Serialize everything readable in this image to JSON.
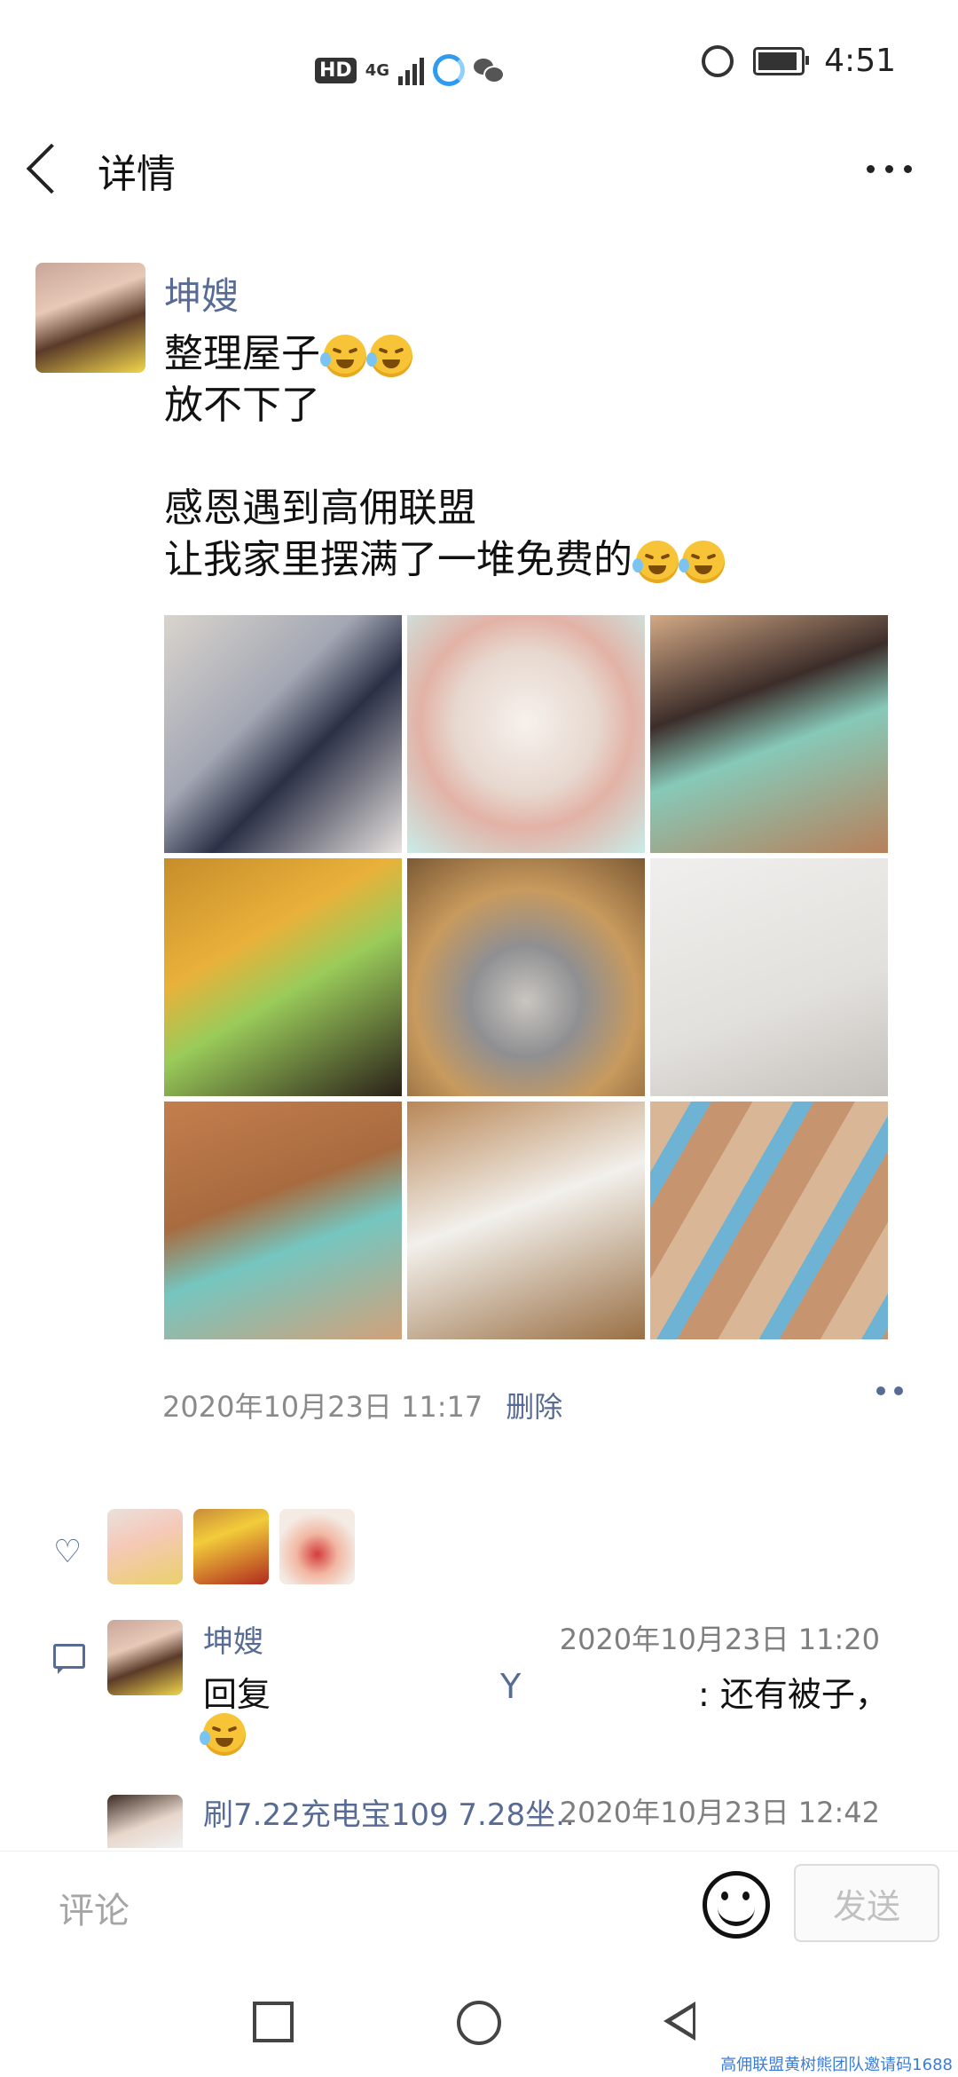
{
  "status_bar": {
    "hd": "HD",
    "network": "4G",
    "time": "4:51"
  },
  "header": {
    "title": "详情"
  },
  "post": {
    "author": "坤嫂",
    "lines": [
      "整理屋子",
      "放不下了",
      "",
      "感恩遇到高佣联盟",
      "让我家里摆满了一堆免费的"
    ],
    "timestamp": "2020年10月23日 11:17",
    "delete_label": "删除"
  },
  "comments": [
    {
      "author": "坤嫂",
      "time": "2020年10月23日 11:20",
      "reply_prefix": "回复",
      "reply_to": "Y",
      "text": ": 还有被子，"
    },
    {
      "author": "刷7.22充电宝109 7.28坐...",
      "time": "2020年10月23日 12:42"
    }
  ],
  "input": {
    "placeholder": "评论",
    "send_label": "发送"
  },
  "watermark": "高佣联盟黄树熊团队邀请码1688",
  "colors": {
    "link": "#576b95",
    "background": "#ffffff"
  }
}
